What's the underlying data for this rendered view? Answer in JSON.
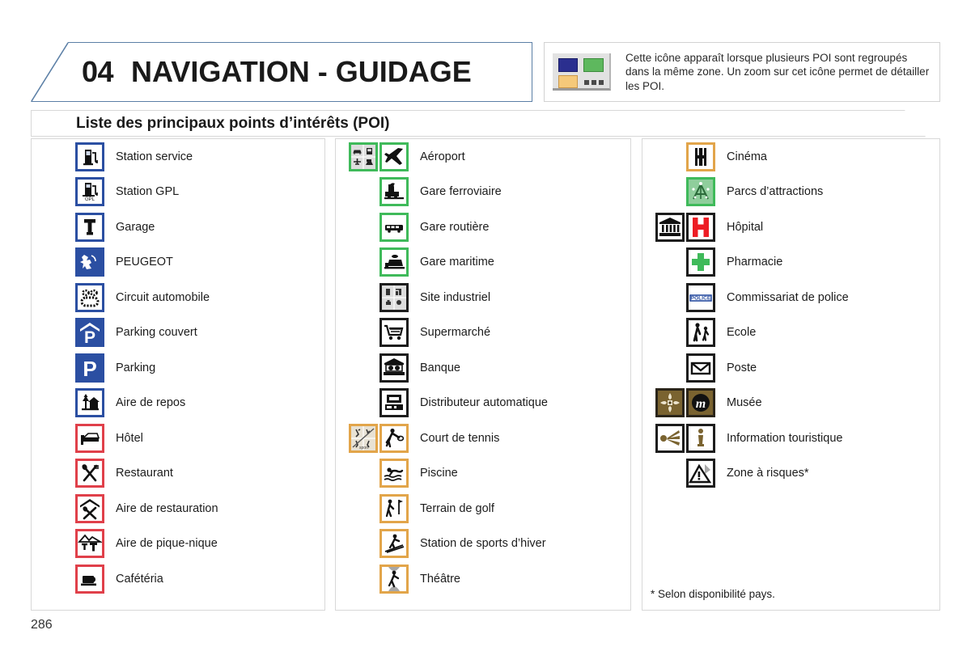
{
  "header": {
    "chapter_number": "04",
    "chapter_title": "NAVIGATION - GUIDAGE",
    "info_icon_name": "grouped-poi-cluster-icon",
    "info_text": "Cette icône apparaît lorsque plusieurs POI sont regroupés dans la même zone. Un zoom sur cet icône permet de détailler les POI."
  },
  "section": {
    "title": "Liste des principaux points d’intérêts (POI)"
  },
  "colors": {
    "blue": "#2b4fa2",
    "red": "#e0404a",
    "green": "#3fba5a",
    "black": "#1d1d1d",
    "orange": "#e2a54a",
    "brown": "#2a2419",
    "park_green": "#8fce9c",
    "museum_brown": "#7a6330",
    "theatre_grey": "#a6a6a6",
    "hospital_red": "#ed1c24",
    "pharmacy_green": "#3fba5a",
    "police_blue": "#2b4fa2"
  },
  "columns": [
    {
      "id": "column-1",
      "rows": [
        {
          "label": "Station service",
          "icons": [
            "fuel-pump-icon"
          ]
        },
        {
          "label": "Station GPL",
          "icons": [
            "lpg-pump-icon"
          ]
        },
        {
          "label": "Garage",
          "icons": [
            "wrench-garage-icon"
          ]
        },
        {
          "label": "PEUGEOT",
          "icons": [
            "peugeot-lion-icon"
          ]
        },
        {
          "label": "Circuit automobile",
          "icons": [
            "race-track-icon"
          ]
        },
        {
          "label": "Parking couvert",
          "icons": [
            "covered-parking-icon"
          ]
        },
        {
          "label": "Parking",
          "icons": [
            "parking-icon"
          ]
        },
        {
          "label": "Aire de repos",
          "icons": [
            "rest-area-icon"
          ]
        },
        {
          "label": "Hôtel",
          "icons": [
            "hotel-bed-icon"
          ]
        },
        {
          "label": "Restaurant",
          "icons": [
            "restaurant-cutlery-icon"
          ]
        },
        {
          "label": "Aire de restauration",
          "icons": [
            "food-area-icon"
          ]
        },
        {
          "label": "Aire de pique-nique",
          "icons": [
            "picnic-area-icon"
          ]
        },
        {
          "label": "Cafétéria",
          "icons": [
            "cafeteria-cup-icon"
          ]
        }
      ]
    },
    {
      "id": "column-2",
      "rows": [
        {
          "label": "Aéroport",
          "icons": [
            "transport-cluster-icon",
            "airplane-icon"
          ]
        },
        {
          "label": "Gare ferroviaire",
          "icons": [
            "train-station-icon"
          ]
        },
        {
          "label": "Gare routière",
          "icons": [
            "bus-station-icon"
          ]
        },
        {
          "label": "Gare maritime",
          "icons": [
            "ferry-terminal-icon"
          ]
        },
        {
          "label": "Site industriel",
          "icons": [
            "industrial-cluster-icon"
          ]
        },
        {
          "label": "Supermarché",
          "icons": [
            "shopping-cart-icon"
          ]
        },
        {
          "label": "Banque",
          "icons": [
            "bank-icon"
          ]
        },
        {
          "label": "Distributeur automatique",
          "icons": [
            "atm-icon"
          ]
        },
        {
          "label": "Court de tennis",
          "icons": [
            "sport-cluster-icon",
            "tennis-icon"
          ]
        },
        {
          "label": "Piscine",
          "icons": [
            "swimming-icon"
          ]
        },
        {
          "label": "Terrain de golf",
          "icons": [
            "golf-icon"
          ]
        },
        {
          "label": "Station de sports d’hiver",
          "icons": [
            "ski-resort-icon"
          ]
        },
        {
          "label": "Théâtre",
          "icons": [
            "theatre-icon"
          ]
        }
      ]
    },
    {
      "id": "column-3",
      "rows": [
        {
          "label": "Cinéma",
          "icons": [
            "cinema-film-icon"
          ]
        },
        {
          "label": "Parcs d’attractions",
          "icons": [
            "amusement-park-icon"
          ]
        },
        {
          "label": "Hôpital",
          "icons": [
            "public-building-icon",
            "hospital-h-icon"
          ]
        },
        {
          "label": "Pharmacie",
          "icons": [
            "pharmacy-cross-icon"
          ]
        },
        {
          "label": "Commissariat de police",
          "icons": [
            "police-station-icon"
          ]
        },
        {
          "label": "Ecole",
          "icons": [
            "school-children-icon"
          ]
        },
        {
          "label": "Poste",
          "icons": [
            "post-envelope-icon"
          ]
        },
        {
          "label": "Musée",
          "icons": [
            "culture-cluster-icon",
            "museum-m-icon"
          ]
        },
        {
          "label": "Information touristique",
          "icons": [
            "tourist-beam-icon",
            "information-i-icon"
          ]
        },
        {
          "label": "Zone à risques*",
          "icons": [
            "risk-zone-warning-icon"
          ]
        }
      ],
      "footnote": "* Selon disponibilité pays."
    }
  ],
  "page_number": "286"
}
